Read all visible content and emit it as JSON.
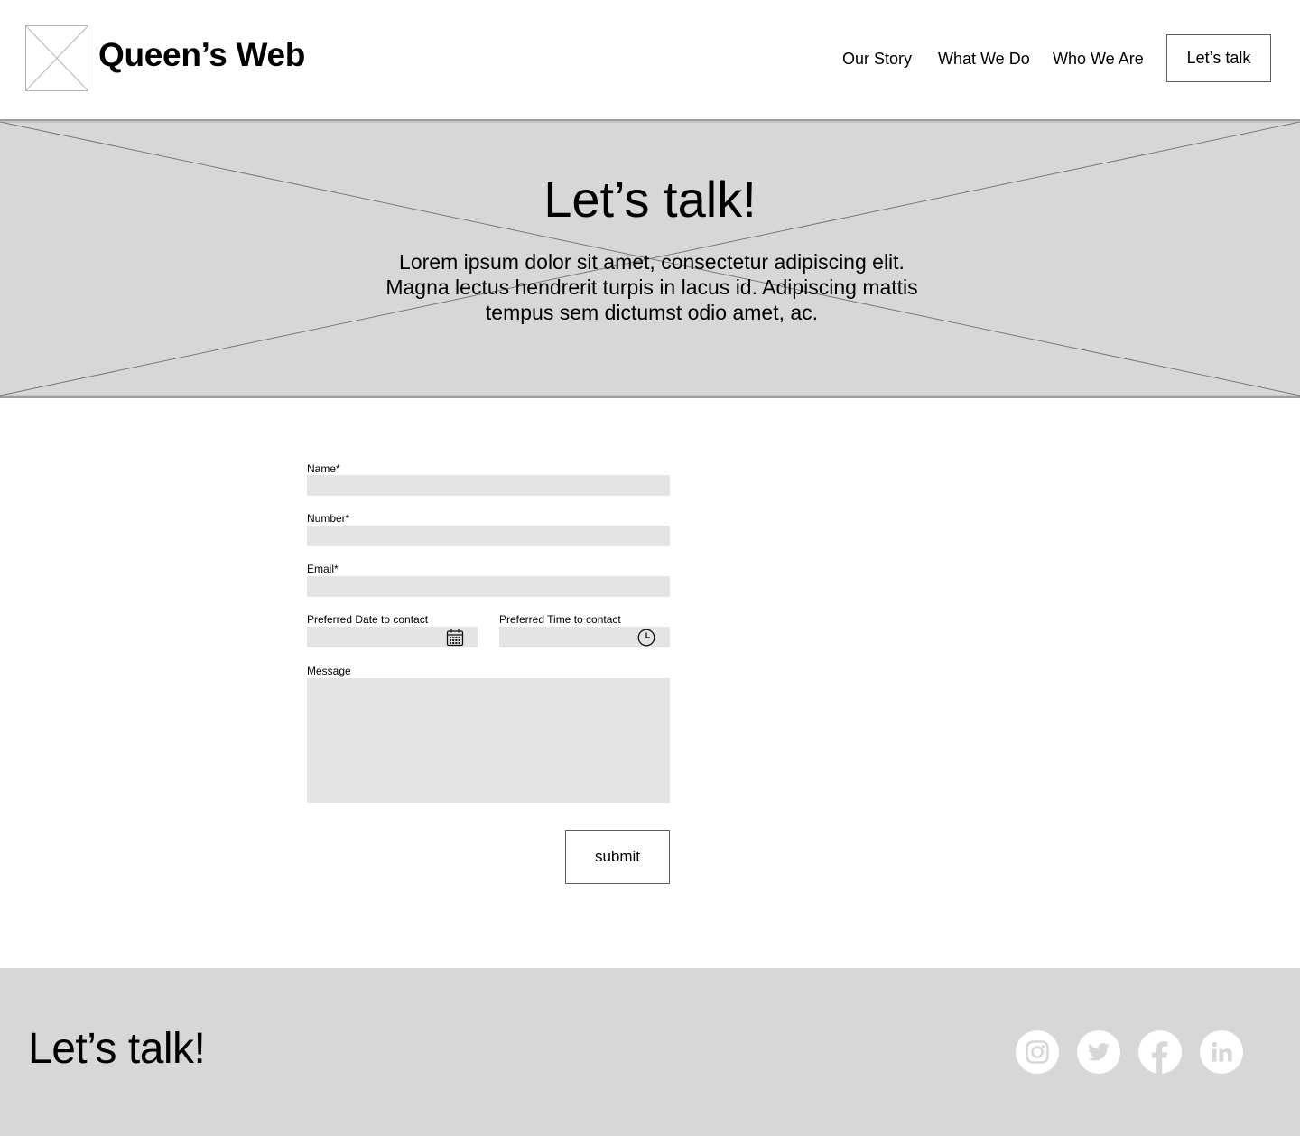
{
  "header": {
    "logo_icon": "image-placeholder-icon",
    "site_title": "Queen’s Web",
    "nav": [
      "Our Story",
      "What We Do",
      "Who We Are"
    ],
    "cta_label": "Let’s talk"
  },
  "hero": {
    "background_icon": "image-placeholder-icon",
    "title": "Let’s talk!",
    "text": "Lorem ipsum dolor sit amet, consectetur adipiscing elit. Magna lectus hendrerit turpis in lacus id. Adipiscing mattis tempus sem dictumst odio amet, ac."
  },
  "form": {
    "name_label": "Name*",
    "name_value": "",
    "number_label": "Number*",
    "number_value": "",
    "email_label": "Email*",
    "email_value": "",
    "date_label": "Preferred Date to contact",
    "date_value": "",
    "date_icon": "calendar-icon",
    "time_label": "Preferred Time to contact",
    "time_value": "",
    "time_icon": "clock-icon",
    "message_label": "Message",
    "message_value": "",
    "submit_label": "submit"
  },
  "footer": {
    "title": "Let’s talk!",
    "social": [
      "instagram-icon",
      "twitter-icon",
      "facebook-icon",
      "linkedin-icon"
    ]
  },
  "colors": {
    "placeholder_gray": "#d7d7d7",
    "input_gray": "#e4e4e4",
    "border_gray": "#5e5e5e",
    "social_circle": "#ffffff",
    "social_glyph": "#d7d7d7"
  }
}
